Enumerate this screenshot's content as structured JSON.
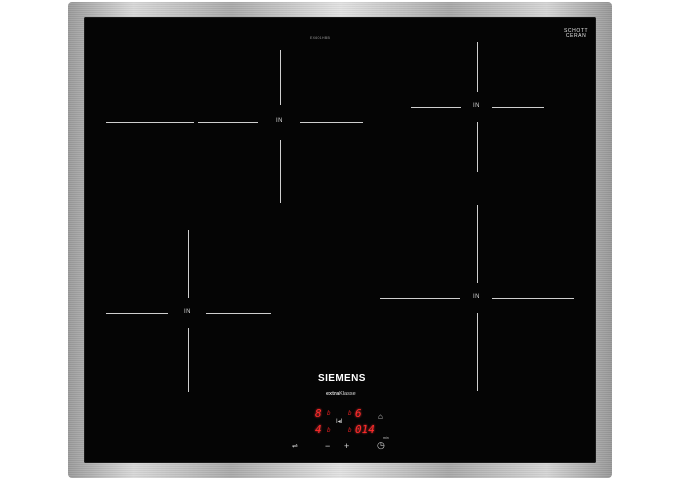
{
  "model_label": "EX601HBB",
  "glass_maker": {
    "line1": "SCHOTT",
    "line2": "CERAN",
    "sub": ""
  },
  "zones": [
    {
      "id": "top-left",
      "label": "IN"
    },
    {
      "id": "top-right",
      "label": "IN"
    },
    {
      "id": "bottom-left",
      "label": "IN"
    },
    {
      "id": "bottom-right",
      "label": "IN"
    }
  ],
  "brand": {
    "name": "SIEMENS",
    "sub_bold": "extra",
    "sub_light": "Klasse"
  },
  "display": {
    "power_left_top": "8",
    "power_left_bottom": "4",
    "power_right_top": "6",
    "timer": "014",
    "b_marker": "b",
    "timer_unit": "min"
  },
  "controls": {
    "minus": "−",
    "plus": "+",
    "lock_symbol": "⌂",
    "timer_symbol": "◷",
    "wipe_symbol": "⇌"
  },
  "colors": {
    "display": "#ff2a2a",
    "glass": "#050505",
    "frame": "#b8b8b8"
  }
}
